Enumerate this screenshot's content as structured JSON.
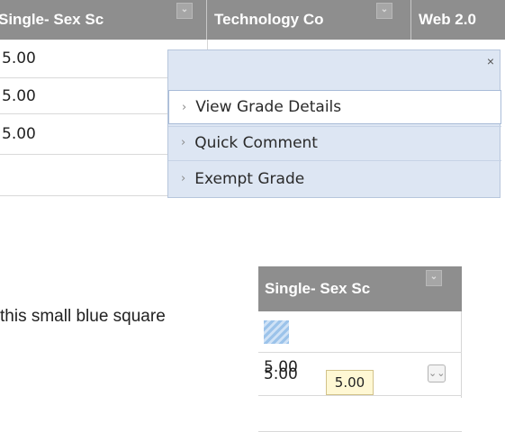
{
  "top_grid": {
    "columns": [
      "Single- Sex Sc",
      "Technology Co",
      "Web 2.0"
    ],
    "rows": [
      "5.00",
      "5.00",
      "5.00"
    ]
  },
  "context_menu": {
    "close": "×",
    "items": [
      "View Grade Details",
      "Quick Comment",
      "Exempt Grade"
    ]
  },
  "caption": "this small blue square",
  "lower_grid": {
    "column": "Single- Sex Sc",
    "rows": [
      "5.00",
      "5.00"
    ]
  },
  "tooltip": "5.00",
  "icons": {
    "sort": "chevron-down-icon",
    "chevron": "chevron-right-icon",
    "dropdown": "double-chevron-down-icon"
  }
}
